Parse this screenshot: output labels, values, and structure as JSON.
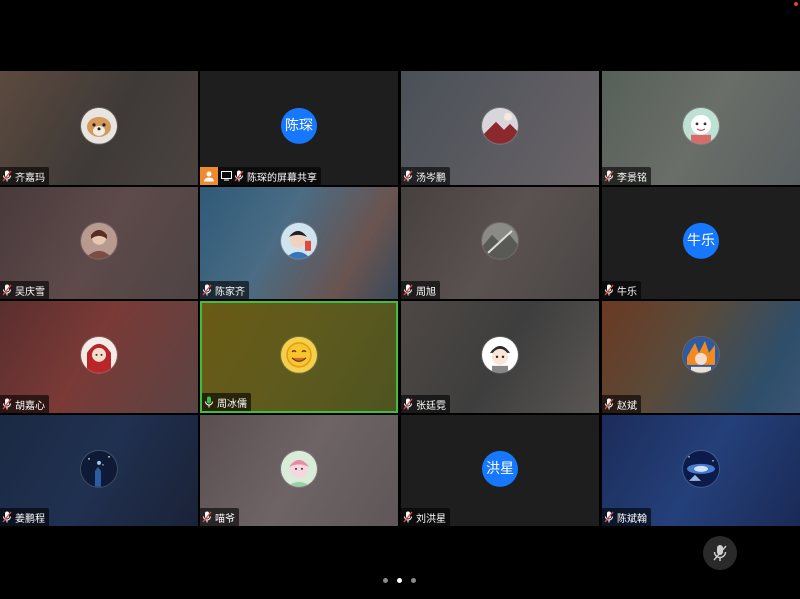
{
  "participants": [
    {
      "name": "齐嘉玛",
      "avatar_icon": "dog-avatar-icon",
      "mic": "muted"
    },
    {
      "name": "陈琛的屏幕共享",
      "avatar_text": "陈琛",
      "mic": "muted",
      "screen_share": true
    },
    {
      "name": "汤岑鹏",
      "avatar_icon": "landscape-avatar-icon",
      "mic": "muted"
    },
    {
      "name": "李景铭",
      "avatar_icon": "cartoon-avatar-icon",
      "mic": "muted"
    },
    {
      "name": "吴庆雪",
      "avatar_icon": "photo-avatar-icon",
      "mic": "muted"
    },
    {
      "name": "陈家齐",
      "avatar_icon": "anime-avatar-icon",
      "mic": "muted"
    },
    {
      "name": "周旭",
      "avatar_icon": "photo-avatar-icon",
      "mic": "muted"
    },
    {
      "name": "牛乐",
      "avatar_text": "牛乐",
      "mic": "muted"
    },
    {
      "name": "胡嘉心",
      "avatar_icon": "anime-girl-avatar-icon",
      "mic": "muted"
    },
    {
      "name": "周冰儒",
      "avatar_icon": "smiley-avatar-icon",
      "mic": "active",
      "speaking": true
    },
    {
      "name": "张廷霓",
      "avatar_icon": "cartoon-boy-avatar-icon",
      "mic": "muted"
    },
    {
      "name": "赵斌",
      "avatar_icon": "anime-avatar-icon",
      "mic": "muted"
    },
    {
      "name": "姜鹏程",
      "avatar_icon": "night-sky-avatar-icon",
      "mic": "muted"
    },
    {
      "name": "喵爷",
      "avatar_icon": "cartoon-avatar-icon",
      "mic": "muted"
    },
    {
      "name": "刘洪星",
      "avatar_text": "洪星",
      "mic": "muted"
    },
    {
      "name": "陈斌翰",
      "avatar_icon": "galaxy-avatar-icon",
      "mic": "muted"
    }
  ],
  "pagination": {
    "pages": 3,
    "current": 2
  },
  "colors": {
    "avatar_blue": "#1677ff",
    "speaking_border": "#3fbf3f",
    "muted_mic": "#e24a4a",
    "share_orange": "#f08a30"
  }
}
